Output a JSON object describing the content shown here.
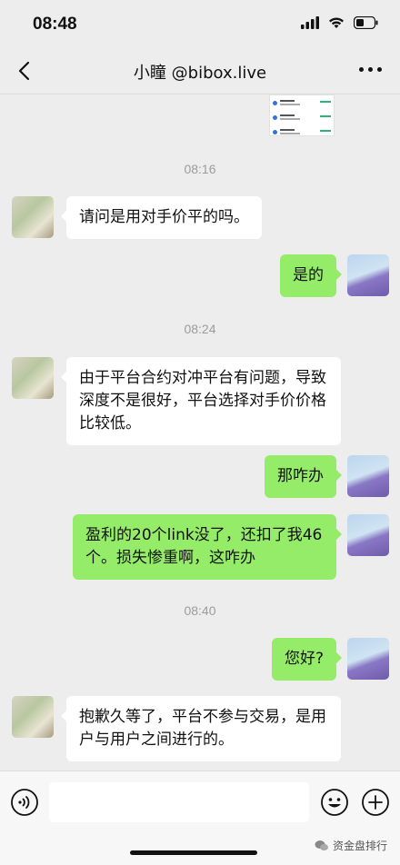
{
  "status_bar": {
    "time": "08:48"
  },
  "nav": {
    "title": "小瞳 @bibox.live"
  },
  "times": {
    "t1": "08:16",
    "t2": "08:24",
    "t3": "08:40"
  },
  "messages": [
    {
      "side": "left",
      "text": "请问是用对手价平的吗。"
    },
    {
      "side": "right",
      "text": "是的"
    },
    {
      "side": "left",
      "text": "由于平台合约对冲平台有问题，导致深度不是很好，平台选择对手价价格比较低。"
    },
    {
      "side": "right",
      "text": "那咋办"
    },
    {
      "side": "right",
      "text": "盈利的20个link没了，还扣了我46个。损失惨重啊，这咋办"
    },
    {
      "side": "right",
      "text": "您好?"
    },
    {
      "side": "left",
      "text": "抱歉久等了，平台不参与交易，是用户与用户之间进行的。"
    }
  ],
  "input": {
    "placeholder": ""
  },
  "watermark": {
    "text": "资金盘排行"
  },
  "colors": {
    "bubble_self": "#95ec69",
    "bubble_other": "#ffffff",
    "background": "#ededed"
  },
  "icons": [
    "back-arrow-icon",
    "more-dots-icon",
    "voice-icon",
    "emoji-icon",
    "add-icon",
    "signal-icon",
    "wifi-icon",
    "battery-icon"
  ]
}
